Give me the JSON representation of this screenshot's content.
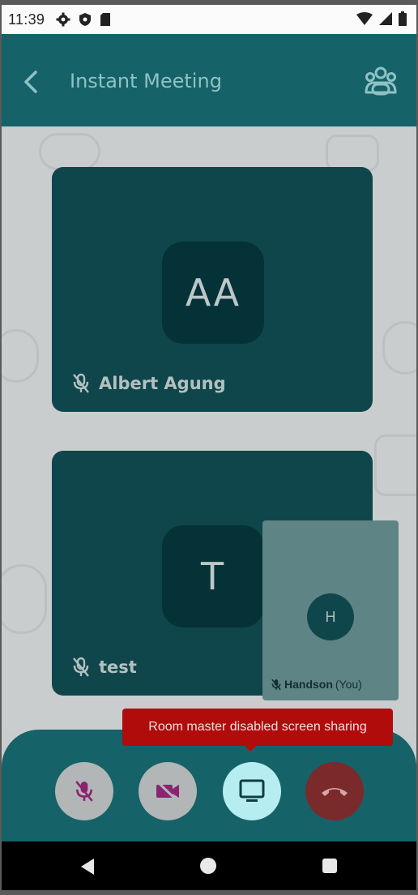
{
  "status_bar": {
    "time": "11:39",
    "left_icons": [
      "settings-icon",
      "shield-icon",
      "sd-card-icon"
    ],
    "right_icons": [
      "wifi-icon",
      "signal-icon",
      "battery-icon"
    ]
  },
  "app_bar": {
    "title": "Instant Meeting",
    "back_icon": "chevron-left-icon",
    "participants_icon": "people-icon"
  },
  "participants": [
    {
      "initials": "AA",
      "name": "Albert Agung",
      "muted": true
    },
    {
      "initials": "T",
      "name": "test",
      "muted": true
    }
  ],
  "self_view": {
    "initials": "H",
    "name": "Handson",
    "suffix": "(You)",
    "muted": true
  },
  "toast": {
    "message": "Room master disabled screen sharing"
  },
  "controls": {
    "mic": {
      "icon": "mic-off-icon",
      "state": "off"
    },
    "video": {
      "icon": "video-off-icon",
      "state": "off"
    },
    "share": {
      "icon": "screen-share-icon",
      "state": "active"
    },
    "hangup": {
      "icon": "phone-hangup-icon"
    }
  },
  "colors": {
    "app_bar": "#156268",
    "tile": "#0f464b",
    "toast": "#b00c0c",
    "share_active": "#b6edf1",
    "hangup": "#7a2a2a"
  },
  "nav_bar": [
    "back-nav-icon",
    "home-nav-icon",
    "recents-nav-icon"
  ]
}
